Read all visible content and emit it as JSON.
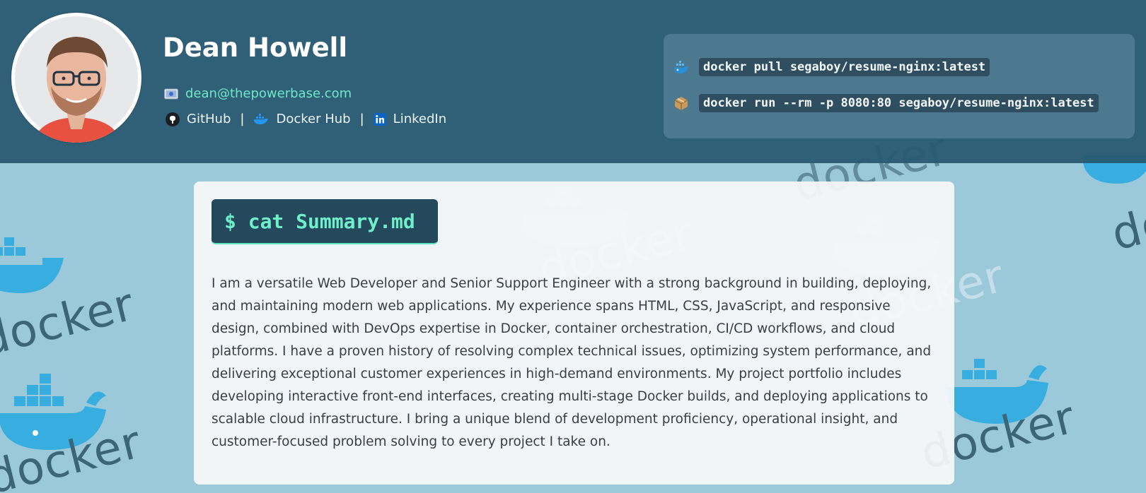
{
  "profile": {
    "name": "Dean Howell",
    "email": "dean@thepowerbase.com",
    "links": [
      {
        "label": "GitHub",
        "icon": "github-icon"
      },
      {
        "label": "Docker Hub",
        "icon": "docker-icon"
      },
      {
        "label": "LinkedIn",
        "icon": "linkedin-icon"
      }
    ],
    "separator": "|"
  },
  "commands": [
    {
      "icon": "docker-whale-icon",
      "text": "docker pull segaboy/resume-nginx:latest"
    },
    {
      "icon": "package-icon",
      "text": "docker run --rm -p 8080:80 segaboy/resume-nginx:latest"
    }
  ],
  "summary": {
    "heading": "$ cat Summary.md",
    "text": "I am a versatile Web Developer and Senior Support Engineer with a strong background in building, deploying, and maintaining modern web applications. My experience spans HTML, CSS, JavaScript, and responsive design, combined with DevOps expertise in Docker, container orchestration, CI/CD workflows, and cloud platforms. I have a proven history of resolving complex technical issues, optimizing system performance, and delivering exceptional customer experiences in high-demand environments. My project portfolio includes developing interactive front-end interfaces, creating multi-stage Docker builds, and deploying applications to scalable cloud infrastructure. I bring a unique blend of development proficiency, operational insight, and customer-focused problem solving to every project I take on."
  },
  "background": {
    "watermark": "docker"
  },
  "colors": {
    "header": "#285870",
    "accent": "#6ee8c6",
    "page_bg": "#9cc9d9",
    "terminal_bg": "#24485c"
  }
}
